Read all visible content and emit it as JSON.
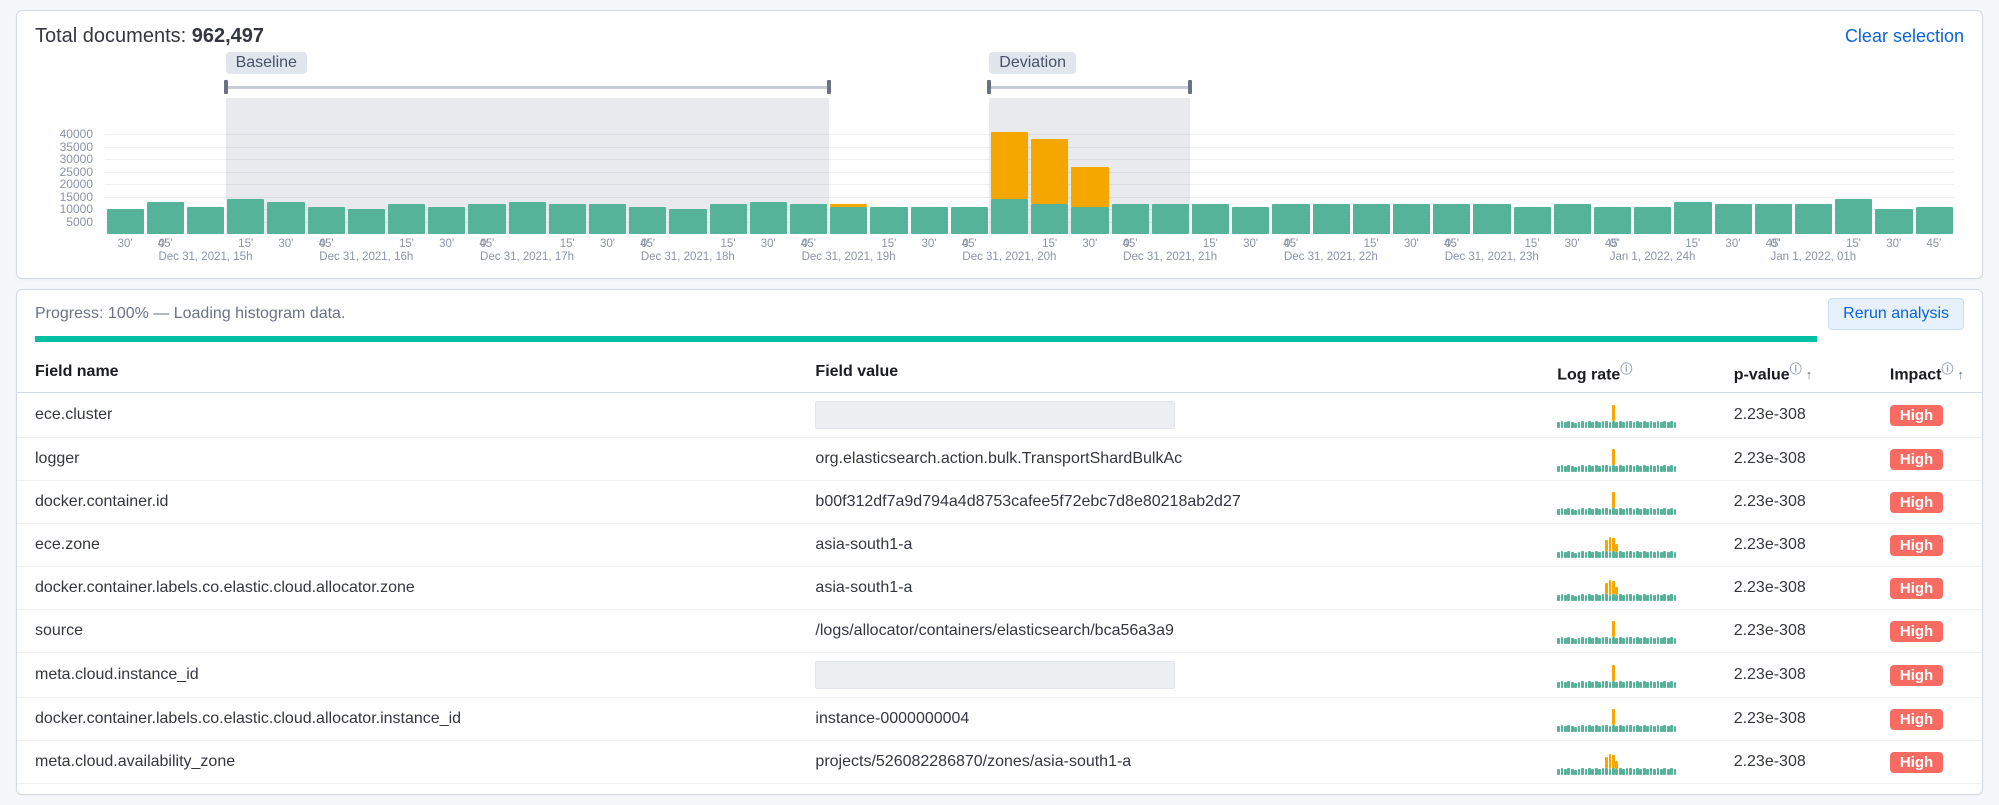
{
  "header": {
    "totalLabel": "Total documents: ",
    "totalValue": "962,497",
    "clearSelection": "Clear selection"
  },
  "ranges": {
    "baselineLabel": "Baseline",
    "deviationLabel": "Deviation"
  },
  "chart_data": {
    "type": "bar",
    "ylabel": "",
    "ylim": [
      0,
      40000
    ],
    "yticks": [
      5000,
      10000,
      15000,
      20000,
      25000,
      30000,
      35000,
      40000
    ],
    "xmajor": [
      {
        "i": 0,
        "l1": "0'",
        "l2": "Dec 31, 2021, 15h"
      },
      {
        "i": 4,
        "l1": "0'",
        "l2": "Dec 31, 2021, 16h"
      },
      {
        "i": 8,
        "l1": "0'",
        "l2": "Dec 31, 2021, 17h"
      },
      {
        "i": 12,
        "l1": "0'",
        "l2": "Dec 31, 2021, 18h"
      },
      {
        "i": 16,
        "l1": "0'",
        "l2": "Dec 31, 2021, 19h"
      },
      {
        "i": 20,
        "l1": "0'",
        "l2": "Dec 31, 2021, 20h"
      },
      {
        "i": 24,
        "l1": "0'",
        "l2": "Dec 31, 2021, 21h"
      },
      {
        "i": 28,
        "l1": "0'",
        "l2": "Dec 31, 2021, 22h"
      },
      {
        "i": 32,
        "l1": "0'",
        "l2": "Dec 31, 2021, 23h"
      },
      {
        "i": 36,
        "l1": "0'",
        "l2": "Jan 1, 2022, 24h"
      },
      {
        "i": 40,
        "l1": "0'",
        "l2": "Jan 1, 2022, 01h"
      }
    ],
    "xminor": [
      "30'",
      "45'",
      "15'",
      "30'",
      "45'",
      "15'",
      "30'",
      "45'",
      "15'",
      "30'",
      "45'",
      "15'",
      "30'",
      "45'",
      "15'",
      "30'",
      "45'",
      "15'",
      "30'",
      "45'",
      "15'",
      "30'",
      "45'",
      "15'",
      "30'",
      "45'",
      "15'",
      "30'",
      "45'",
      "15'",
      "30'",
      "45'",
      "15'",
      "30'",
      "45'",
      "15'"
    ],
    "selection": {
      "baseline": {
        "from": 3,
        "to": 17
      },
      "deviation": {
        "from": 22,
        "to": 26
      }
    },
    "series": [
      {
        "name": "baseline",
        "color": "#54b399"
      },
      {
        "name": "deviation",
        "color": "#f5a700"
      }
    ],
    "bars": [
      {
        "base": 10000,
        "dev": 0
      },
      {
        "base": 13000,
        "dev": 0
      },
      {
        "base": 11000,
        "dev": 0
      },
      {
        "base": 14000,
        "dev": 0
      },
      {
        "base": 13000,
        "dev": 0
      },
      {
        "base": 11000,
        "dev": 0
      },
      {
        "base": 10000,
        "dev": 0
      },
      {
        "base": 12000,
        "dev": 0
      },
      {
        "base": 11000,
        "dev": 0
      },
      {
        "base": 12000,
        "dev": 0
      },
      {
        "base": 13000,
        "dev": 0
      },
      {
        "base": 12000,
        "dev": 0
      },
      {
        "base": 12000,
        "dev": 0
      },
      {
        "base": 11000,
        "dev": 0
      },
      {
        "base": 10000,
        "dev": 0
      },
      {
        "base": 12000,
        "dev": 0
      },
      {
        "base": 13000,
        "dev": 0
      },
      {
        "base": 12000,
        "dev": 0
      },
      {
        "base": 11000,
        "dev": 1000
      },
      {
        "base": 11000,
        "dev": 0
      },
      {
        "base": 11000,
        "dev": 0
      },
      {
        "base": 11000,
        "dev": 0
      },
      {
        "base": 14000,
        "dev": 27000
      },
      {
        "base": 12000,
        "dev": 26000
      },
      {
        "base": 11000,
        "dev": 16000
      },
      {
        "base": 12000,
        "dev": 0
      },
      {
        "base": 12000,
        "dev": 0
      },
      {
        "base": 12000,
        "dev": 0
      },
      {
        "base": 11000,
        "dev": 0
      },
      {
        "base": 12000,
        "dev": 0
      },
      {
        "base": 12000,
        "dev": 0
      },
      {
        "base": 12000,
        "dev": 0
      },
      {
        "base": 12000,
        "dev": 0
      },
      {
        "base": 12000,
        "dev": 0
      },
      {
        "base": 12000,
        "dev": 0
      },
      {
        "base": 11000,
        "dev": 0
      },
      {
        "base": 12000,
        "dev": 0
      },
      {
        "base": 11000,
        "dev": 0
      },
      {
        "base": 11000,
        "dev": 0
      },
      {
        "base": 13000,
        "dev": 0
      },
      {
        "base": 12000,
        "dev": 0
      },
      {
        "base": 12000,
        "dev": 0
      },
      {
        "base": 12000,
        "dev": 0
      },
      {
        "base": 14000,
        "dev": 0
      },
      {
        "base": 10000,
        "dev": 0
      },
      {
        "base": 11000,
        "dev": 0
      }
    ]
  },
  "results": {
    "progressText": "Progress: 100% — Loading histogram data.",
    "rerunLabel": "Rerun analysis",
    "columns": {
      "fieldName": "Field name",
      "fieldValue": "Field value",
      "logRate": "Log rate",
      "pValue": "p-value",
      "impact": "Impact"
    },
    "rows": [
      {
        "field": "ece.cluster",
        "value": "",
        "pvalue": "2.23e-308",
        "impact": "High",
        "redacted": true,
        "spark": "A"
      },
      {
        "field": "logger",
        "value": "org.elasticsearch.action.bulk.TransportShardBulkAc",
        "pvalue": "2.23e-308",
        "impact": "High",
        "spark": "A"
      },
      {
        "field": "docker.container.id",
        "value": "b00f312df7a9d794a4d8753cafee5f72ebc7d8e80218ab2d27",
        "pvalue": "2.23e-308",
        "impact": "High",
        "spark": "A"
      },
      {
        "field": "ece.zone",
        "value": "asia-south1-a",
        "pvalue": "2.23e-308",
        "impact": "High",
        "spark": "B"
      },
      {
        "field": "docker.container.labels.co.elastic.cloud.allocator.zone",
        "value": "asia-south1-a",
        "pvalue": "2.23e-308",
        "impact": "High",
        "spark": "B"
      },
      {
        "field": "source",
        "value": "/logs/allocator/containers/elasticsearch/bca56a3a9",
        "pvalue": "2.23e-308",
        "impact": "High",
        "spark": "A"
      },
      {
        "field": "meta.cloud.instance_id",
        "value": "",
        "pvalue": "2.23e-308",
        "impact": "High",
        "redacted": true,
        "spark": "A"
      },
      {
        "field": "docker.container.labels.co.elastic.cloud.allocator.instance_id",
        "value": "instance-0000000004",
        "pvalue": "2.23e-308",
        "impact": "High",
        "spark": "A"
      },
      {
        "field": "meta.cloud.availability_zone",
        "value": "projects/526082286870/zones/asia-south1-a",
        "pvalue": "2.23e-308",
        "impact": "High",
        "spark": "B"
      }
    ],
    "spark": {
      "A": {
        "green": [
          6,
          7,
          6,
          7,
          6,
          5,
          6,
          7,
          6,
          7,
          6,
          7,
          6,
          7,
          7,
          6,
          7,
          6,
          7,
          6,
          7,
          7,
          6,
          7,
          6,
          7,
          6,
          7,
          6,
          7,
          6,
          7,
          6,
          7,
          6
        ],
        "orange": [
          0,
          0,
          0,
          0,
          0,
          0,
          0,
          0,
          0,
          0,
          0,
          0,
          0,
          0,
          0,
          0,
          16,
          0,
          0,
          0,
          0,
          0,
          0,
          0,
          0,
          0,
          0,
          0,
          0,
          0,
          0,
          0,
          0,
          0,
          0
        ]
      },
      "B": {
        "green": [
          6,
          7,
          6,
          7,
          6,
          5,
          6,
          7,
          6,
          7,
          6,
          7,
          6,
          7,
          7,
          6,
          7,
          6,
          7,
          6,
          7,
          7,
          6,
          7,
          6,
          7,
          6,
          7,
          6,
          7,
          6,
          7,
          6,
          7,
          6
        ],
        "orange": [
          0,
          0,
          0,
          0,
          0,
          0,
          0,
          0,
          0,
          0,
          0,
          0,
          0,
          0,
          11,
          15,
          13,
          8,
          0,
          0,
          0,
          0,
          0,
          0,
          0,
          0,
          0,
          0,
          0,
          0,
          0,
          0,
          0,
          0,
          0
        ]
      }
    }
  }
}
